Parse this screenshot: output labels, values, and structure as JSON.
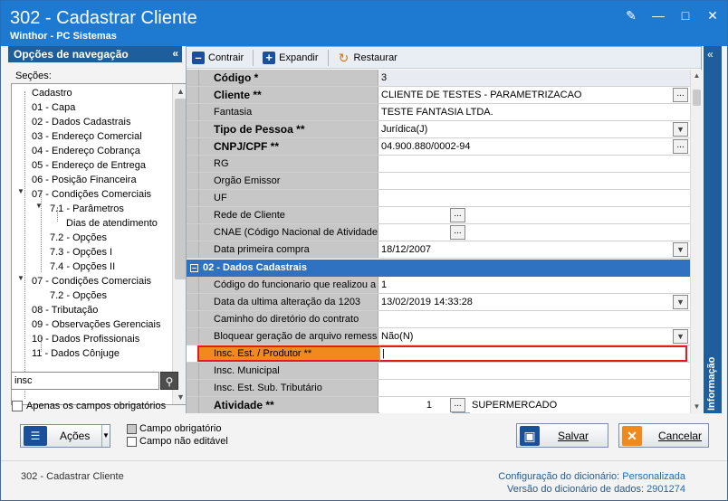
{
  "window": {
    "title": "302 - Cadastrar Cliente",
    "subtitle": "Winthor - PC Sistemas"
  },
  "nav": {
    "header": "Opções de navegação",
    "sections_label": "Seções:",
    "items": [
      {
        "label": "Cadastro"
      },
      {
        "label": "01 - Capa"
      },
      {
        "label": "02 - Dados Cadastrais"
      },
      {
        "label": "03 - Endereço Comercial"
      },
      {
        "label": "04 - Endereço Cobrança"
      },
      {
        "label": "05 - Endereço de Entrega"
      },
      {
        "label": "06 - Posição Financeira"
      },
      {
        "label": "07 - Condições Comerciais"
      },
      {
        "label": "7.1 - Parâmetros"
      },
      {
        "label": "Dias de atendimento"
      },
      {
        "label": "7.2 - Opções"
      },
      {
        "label": "7.3 - Opções I"
      },
      {
        "label": "7.4 - Opções II"
      },
      {
        "label": "07 - Condições Comerciais"
      },
      {
        "label": "7.2 - Opções"
      },
      {
        "label": "08 - Tributação"
      },
      {
        "label": "09 - Observações Gerenciais"
      },
      {
        "label": "10 - Dados Profissionais"
      },
      {
        "label": "11 - Dados Cônjuge"
      }
    ],
    "search_value": "insc",
    "only_required_label": "Apenas os campos obrigatórios"
  },
  "toolbar": {
    "collapse_label": "Contrair",
    "expand_label": "Expandir",
    "restore_label": "Restaurar"
  },
  "grid": {
    "rows": [
      {
        "label": "Código *",
        "value": "3"
      },
      {
        "label": "Cliente **",
        "value": "CLIENTE DE TESTES - PARAMETRIZACAO"
      },
      {
        "label": "Fantasia",
        "value": "TESTE FANTASIA LTDA."
      },
      {
        "label": "Tipo de Pessoa **",
        "value": "Jurídica(J)"
      },
      {
        "label": "CNPJ/CPF **",
        "value": "04.900.880/0002-94"
      },
      {
        "label": "RG",
        "value": ""
      },
      {
        "label": "Orgão Emissor",
        "value": ""
      },
      {
        "label": "UF",
        "value": ""
      },
      {
        "label": "Rede de Cliente",
        "value": ""
      },
      {
        "label": "CNAE (Código Nacional de Atividade E",
        "value": ""
      },
      {
        "label": "Data primeira compra",
        "value": "18/12/2007"
      }
    ],
    "section2_title": "02 - Dados Cadastrais",
    "rows2": [
      {
        "label": "Código do funcionario que realizou a (",
        "value": "1"
      },
      {
        "label": "Data da ultima alteração da 1203",
        "value": "13/02/2019 14:33:28"
      },
      {
        "label": "Caminho do diretório do contrato",
        "value": ""
      },
      {
        "label": "Bloquear geração de arquivo remessa",
        "value": "Não(N)"
      },
      {
        "label": "Insc. Est. / Produtor **",
        "value": ""
      },
      {
        "label": "Insc. Municipal",
        "value": ""
      },
      {
        "label": "Insc. Est. Sub. Tributário",
        "value": ""
      },
      {
        "label": "Atividade **",
        "value_code": "1",
        "value": "SUPERMERCADO"
      }
    ]
  },
  "info_panel": {
    "label": "Informação"
  },
  "bottom": {
    "actions_label": "Ações",
    "legend_required": "Campo obrigatório",
    "legend_readonly": "Campo não editável",
    "save_label": "Salvar",
    "cancel_label": "Cancelar"
  },
  "footer": {
    "screen": "302 - Cadastrar Cliente",
    "dict_config_label": "Configuração do dicionário:",
    "dict_config_value": "Personalizada",
    "dict_version_label": "Versão do dicionário de dados:",
    "dict_version_value": "2901274"
  },
  "colors": {
    "titlebar": "#1e7ad0",
    "section": "#2f72c2",
    "highlight_row": "#f08a1c",
    "highlight_border": "#e01c1c"
  }
}
